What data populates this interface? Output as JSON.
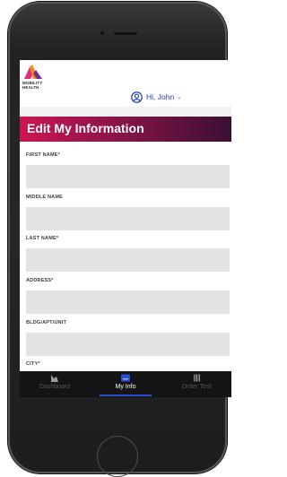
{
  "app": {
    "logo_line1": "MOBILITY",
    "logo_line2": "HEALTH",
    "greeting": "Hi, John",
    "caret": "⌄"
  },
  "page": {
    "title": "Edit My Information"
  },
  "form": {
    "fields": [
      {
        "label": "FIRST NAME*",
        "value": ""
      },
      {
        "label": "MIDDLE NAME",
        "value": ""
      },
      {
        "label": "LAST NAME*",
        "value": ""
      },
      {
        "label": "ADDRESS*",
        "value": ""
      },
      {
        "label": "BLDG/APT/UNIT",
        "value": ""
      },
      {
        "label": "CITY*",
        "value": ""
      }
    ]
  },
  "tabs": [
    {
      "label": "Dashboard",
      "icon": "chart-icon",
      "active": false
    },
    {
      "label": "My Info",
      "icon": "id-card-icon",
      "active": true
    },
    {
      "label": "Order Test",
      "icon": "barcode-icon",
      "active": false
    }
  ],
  "colors": {
    "accent": "#2a4fd0",
    "banner_start": "#cc1652",
    "banner_end": "#3b1033",
    "tabbar": "#141414",
    "field": "#e3e3e3"
  }
}
